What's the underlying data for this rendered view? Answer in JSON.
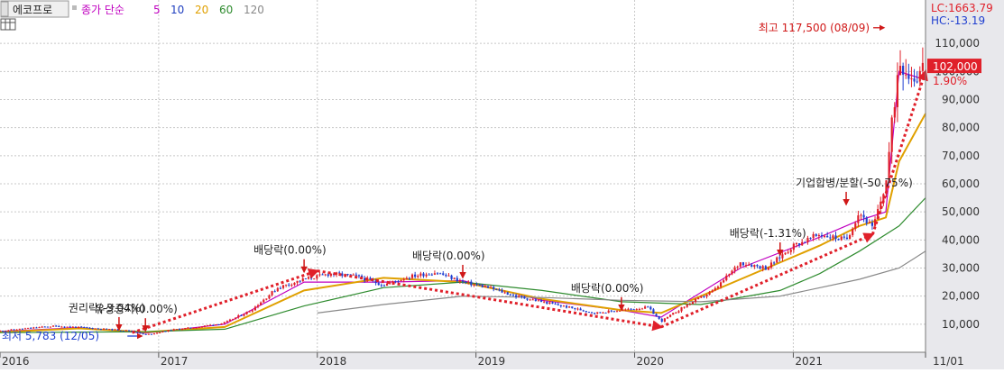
{
  "header": {
    "stock_name": "에코프로",
    "legend": {
      "label_prefix": "종가 단순",
      "items": [
        {
          "label": "5",
          "color": "#c000c0"
        },
        {
          "label": "10",
          "color": "#1f3fbf"
        },
        {
          "label": "20",
          "color": "#e0a000"
        },
        {
          "label": "60",
          "color": "#2e8b2e"
        },
        {
          "label": "120",
          "color": "#888888"
        }
      ]
    }
  },
  "right_panel": {
    "lc_label": "LC:1663.79",
    "hc_label": "HC:-13.19",
    "current_price": "102,000",
    "change_pct": "1.90%"
  },
  "colors": {
    "up": "#e0202a",
    "down": "#1f3fd0",
    "trend_arrow": "#e0202a",
    "event_arrow": "#d01818",
    "grid": "#c8c8c8",
    "axis_bg": "#e8e8ec",
    "price_box": "#e0202a"
  },
  "chart_data": {
    "type": "candlestick",
    "title": "",
    "xlabel": "",
    "ylabel": "",
    "x_range": [
      "2016-01",
      "2021-11"
    ],
    "ylim": [
      0,
      120000
    ],
    "y_ticks": [
      10000,
      20000,
      30000,
      40000,
      50000,
      60000,
      70000,
      80000,
      90000,
      100000,
      110000
    ],
    "y_tick_labels": [
      "10,000",
      "20,000",
      "30,000",
      "40,000",
      "50,000",
      "60,000",
      "70,000",
      "80,000",
      "90,000",
      "100,000",
      "110,000"
    ],
    "x_ticks": [
      "2016-01",
      "2017-01",
      "2018-01",
      "2019-01",
      "2020-01",
      "2021-01",
      "2021-11"
    ],
    "x_tick_labels": [
      "2016",
      "2017",
      "2018",
      "2019",
      "2020",
      "2021",
      "11/01"
    ],
    "grid": true,
    "price_path": [
      [
        "2016-01",
        7600
      ],
      [
        "2016-03",
        8500
      ],
      [
        "2016-05",
        9300
      ],
      [
        "2016-07",
        8900
      ],
      [
        "2016-09",
        8200
      ],
      [
        "2016-11",
        7600
      ],
      [
        "2016-12",
        6200
      ],
      [
        "2017-02",
        8000
      ],
      [
        "2017-04",
        9000
      ],
      [
        "2017-06",
        10500
      ],
      [
        "2017-08",
        15000
      ],
      [
        "2017-10",
        23000
      ],
      [
        "2017-12",
        26000
      ],
      [
        "2018-02",
        28000
      ],
      [
        "2018-04",
        27000
      ],
      [
        "2018-06",
        24000
      ],
      [
        "2018-08",
        27000
      ],
      [
        "2018-10",
        28500
      ],
      [
        "2018-12",
        25000
      ],
      [
        "2019-02",
        23000
      ],
      [
        "2019-04",
        20000
      ],
      [
        "2019-06",
        18000
      ],
      [
        "2019-08",
        16000
      ],
      [
        "2019-10",
        14000
      ],
      [
        "2019-12",
        15000
      ],
      [
        "2020-02",
        16000
      ],
      [
        "2020-03",
        11000
      ],
      [
        "2020-05",
        17000
      ],
      [
        "2020-07",
        22000
      ],
      [
        "2020-09",
        32000
      ],
      [
        "2020-11",
        30000
      ],
      [
        "2021-01",
        38000
      ],
      [
        "2021-03",
        42000
      ],
      [
        "2021-05",
        40000
      ],
      [
        "2021-06",
        50000
      ],
      [
        "2021-07",
        44000
      ],
      [
        "2021-08",
        60000
      ],
      [
        "2021-09",
        105000
      ],
      [
        "2021-10",
        98000
      ],
      [
        "2021-11",
        102000
      ]
    ],
    "series": [
      {
        "name": "5",
        "points": [
          [
            "2016-01",
            7400
          ],
          [
            "2016-07",
            8800
          ],
          [
            "2016-12",
            6800
          ],
          [
            "2017-06",
            10000
          ],
          [
            "2017-12",
            25000
          ],
          [
            "2018-06",
            25000
          ],
          [
            "2018-12",
            25500
          ],
          [
            "2019-06",
            18500
          ],
          [
            "2019-12",
            15000
          ],
          [
            "2020-03",
            12500
          ],
          [
            "2020-09",
            30000
          ],
          [
            "2021-03",
            41000
          ],
          [
            "2021-06",
            47000
          ],
          [
            "2021-08",
            50000
          ],
          [
            "2021-09",
            100000
          ],
          [
            "2021-11",
            97000
          ]
        ]
      },
      {
        "name": "20",
        "points": [
          [
            "2016-01",
            7200
          ],
          [
            "2016-07",
            8500
          ],
          [
            "2016-12",
            7200
          ],
          [
            "2017-06",
            9000
          ],
          [
            "2017-12",
            22000
          ],
          [
            "2018-06",
            26500
          ],
          [
            "2018-12",
            25000
          ],
          [
            "2019-06",
            19000
          ],
          [
            "2019-12",
            15000
          ],
          [
            "2020-03",
            14000
          ],
          [
            "2020-09",
            26000
          ],
          [
            "2021-03",
            38000
          ],
          [
            "2021-06",
            45000
          ],
          [
            "2021-08",
            48000
          ],
          [
            "2021-09",
            68000
          ],
          [
            "2021-11",
            85000
          ]
        ]
      },
      {
        "name": "60",
        "points": [
          [
            "2016-01",
            7000
          ],
          [
            "2016-12",
            7300
          ],
          [
            "2017-06",
            8200
          ],
          [
            "2017-12",
            16500
          ],
          [
            "2018-06",
            23000
          ],
          [
            "2018-12",
            25000
          ],
          [
            "2019-06",
            22000
          ],
          [
            "2019-12",
            18000
          ],
          [
            "2020-06",
            17000
          ],
          [
            "2020-12",
            22000
          ],
          [
            "2021-03",
            28000
          ],
          [
            "2021-06",
            36000
          ],
          [
            "2021-09",
            45000
          ],
          [
            "2021-11",
            55000
          ]
        ]
      },
      {
        "name": "120",
        "points": [
          [
            "2018-01",
            14000
          ],
          [
            "2018-06",
            17000
          ],
          [
            "2018-12",
            20000
          ],
          [
            "2019-06",
            19500
          ],
          [
            "2019-12",
            18500
          ],
          [
            "2020-06",
            18000
          ],
          [
            "2020-12",
            20000
          ],
          [
            "2021-06",
            26000
          ],
          [
            "2021-09",
            30000
          ],
          [
            "2021-11",
            36000
          ]
        ]
      }
    ],
    "trend_lines": [
      [
        [
          "2016-11",
          7000
        ],
        [
          "2018-01",
          29000
        ]
      ],
      [
        [
          "2018-01",
          29000
        ],
        [
          "2020-03",
          9000
        ]
      ],
      [
        [
          "2020-03",
          9000
        ],
        [
          "2021-07",
          42000
        ]
      ],
      [
        [
          "2021-07",
          42000
        ],
        [
          "2021-11",
          100000
        ]
      ]
    ],
    "annotations": [
      {
        "label": "최고 117,500 (08/09)",
        "kind": "high",
        "date": "2021-08",
        "value": 117500
      },
      {
        "label": "최저 5,783 (12/05)",
        "kind": "low",
        "date": "2016-12",
        "value": 5783
      },
      {
        "label": "권리락(-3.04%)",
        "kind": "event",
        "date": "2016-10",
        "value": 7400
      },
      {
        "label": "유상증자(0.00%)",
        "kind": "event",
        "date": "2016-12",
        "value": 7000
      },
      {
        "label": "배당락(0.00%)",
        "kind": "event",
        "date": "2017-12",
        "value": 28000
      },
      {
        "label": "배당락(0.00%)",
        "kind": "event",
        "date": "2018-12",
        "value": 26000
      },
      {
        "label": "배당락(0.00%)",
        "kind": "event",
        "date": "2019-12",
        "value": 14500
      },
      {
        "label": "배당락(-1.31%)",
        "kind": "event",
        "date": "2020-12",
        "value": 34000
      },
      {
        "label": "기업합병/분할(-50.75%)",
        "kind": "event",
        "date": "2021-05",
        "value": 52000
      }
    ]
  }
}
